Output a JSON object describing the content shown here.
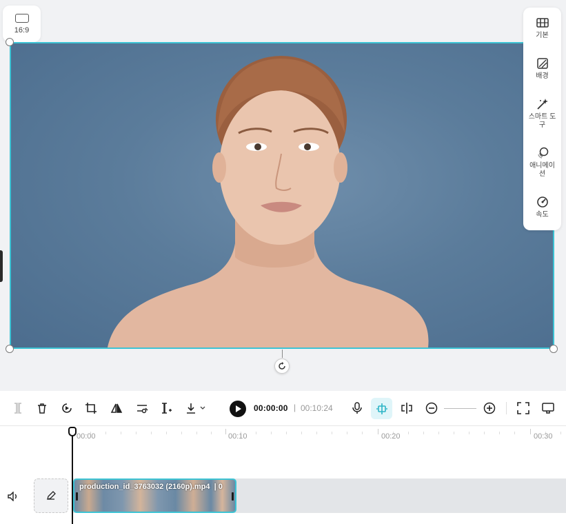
{
  "canvas": {
    "ratio_label": "16:9"
  },
  "right_panel": {
    "items": [
      {
        "label": "기본",
        "icon": "film-icon"
      },
      {
        "label": "배경",
        "icon": "background-icon"
      },
      {
        "label": "스마트 도구",
        "icon": "magic-wand-icon"
      },
      {
        "label": "애니메이션",
        "icon": "animation-icon"
      },
      {
        "label": "속도",
        "icon": "speed-icon"
      }
    ]
  },
  "toolbar": {
    "current_time": "00:00:00",
    "separator": "|",
    "total_time": "00:10:24",
    "accent_color": "#3cc3d4"
  },
  "timeline": {
    "ruler_labels": [
      "00:00",
      "00:10",
      "00:20",
      "00:30"
    ],
    "clip_label": "production_id_3763032 (2160p).mp4",
    "clip_suffix": "0"
  }
}
